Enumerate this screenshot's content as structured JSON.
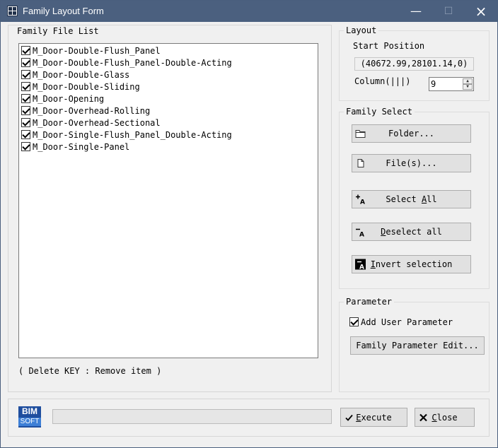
{
  "window": {
    "title": "Family Layout Form"
  },
  "family_file_list": {
    "label": "Family File List",
    "items": [
      {
        "label": "M_Door-Double-Flush_Panel",
        "checked": true
      },
      {
        "label": "M_Door-Double-Flush_Panel-Double-Acting",
        "checked": true
      },
      {
        "label": "M_Door-Double-Glass",
        "checked": true
      },
      {
        "label": "M_Door-Double-Sliding",
        "checked": true
      },
      {
        "label": "M_Door-Opening",
        "checked": true
      },
      {
        "label": "M_Door-Overhead-Rolling",
        "checked": true
      },
      {
        "label": "M_Door-Overhead-Sectional",
        "checked": true
      },
      {
        "label": "M_Door-Single-Flush_Panel_Double-Acting",
        "checked": true
      },
      {
        "label": "M_Door-Single-Panel",
        "checked": true
      }
    ],
    "hint": "( Delete KEY : Remove item )"
  },
  "layout": {
    "label": "Layout",
    "start_position_label": "Start Position",
    "start_position_value": "(40672.99,28101.14,0)",
    "column_label": "Column(|||)",
    "column_value": "9"
  },
  "family_select": {
    "label": "Family Select",
    "folder_label": "Folder...",
    "files_label": "File(s)...",
    "select_all_pre": "Select ",
    "select_all_key": "A",
    "select_all_post": "ll",
    "deselect_key": "D",
    "deselect_post": "eselect all",
    "invert_key": "I",
    "invert_post": "nvert selection"
  },
  "parameter": {
    "label": "Parameter",
    "add_user_parameter_label": "Add User Parameter",
    "add_user_parameter_checked": true,
    "edit_label": "Family Parameter Edit..."
  },
  "footer": {
    "logo_line1": "BIM",
    "logo_line2": "SOFT",
    "progress": 0,
    "execute_key": "E",
    "execute_post": "xecute",
    "close_key": "C",
    "close_post": "lose"
  },
  "colors": {
    "titlebar": "#4b607f",
    "logo": "#1f4e9e"
  }
}
